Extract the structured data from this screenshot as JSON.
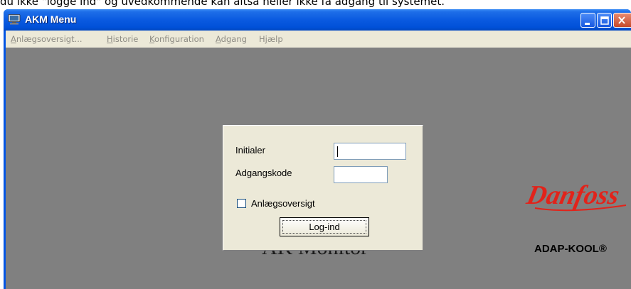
{
  "caption": "du ikke \"logge ind\" og uvedkommende kan altså heller ikke få adgang til systemet.",
  "window": {
    "title": "AKM Menu",
    "icon": "computer-icon",
    "controls": [
      "minimize-icon",
      "maximize-icon",
      "close-icon"
    ]
  },
  "menubar": {
    "items": [
      {
        "label": "Anlægsoversigt...",
        "mnemonic": "A"
      },
      {
        "label": "Historie",
        "mnemonic": "H"
      },
      {
        "label": "Konfiguration",
        "mnemonic": "K"
      },
      {
        "label": "Adgang",
        "mnemonic": "A"
      },
      {
        "label": "Hjælp",
        "mnemonic": "j"
      }
    ]
  },
  "background_title": "AK Monitor",
  "branding": {
    "logo_text": "Danfoss",
    "product": "ADAP-KOOL®",
    "logo_color": "#e2231a"
  },
  "login_dialog": {
    "initials_label": "Initialer",
    "initials_value": "",
    "password_label": "Adgangskode",
    "password_value": "",
    "checkbox_label": "Anlægsoversigt",
    "checkbox_checked": false,
    "login_button": "Log-ind"
  },
  "colors": {
    "titlebar": "#0a5ae0",
    "client_bg": "#808080",
    "dialog_bg": "#ece9d8"
  }
}
